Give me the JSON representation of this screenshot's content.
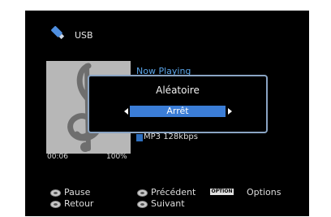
{
  "source": {
    "label": "USB",
    "icon": "usb-stick-icon"
  },
  "now_playing": {
    "header": "Now Playing",
    "format": "MP3 128kbps",
    "elapsed": "00:06",
    "progress": "100%",
    "art_icon": "treble-clef-icon"
  },
  "popup": {
    "title": "Aléatoire",
    "value": "Arrêt"
  },
  "hints": {
    "pause": "Pause",
    "back": "Retour",
    "previous": "Précédent",
    "next": "Suivant",
    "option_badge": "OPTION",
    "options": "Options"
  },
  "colors": {
    "accent": "#3b7dd6",
    "header_text": "#5aa4e8",
    "popup_border": "#8aa4c3"
  }
}
